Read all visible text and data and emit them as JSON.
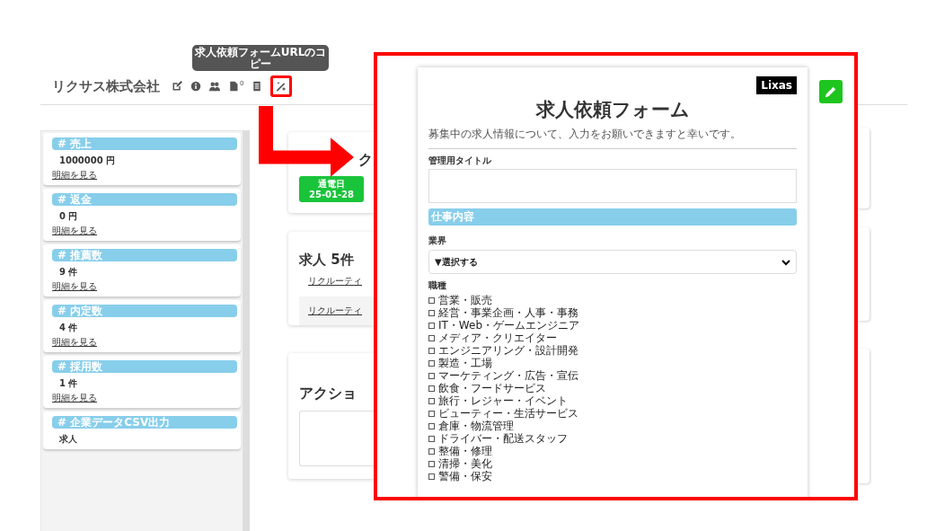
{
  "header": {
    "company": "リクサス株式会社",
    "file_count": "0",
    "tooltip": "求人依頼フォームURLのコピー"
  },
  "sidebar": {
    "cards": [
      {
        "title": "# 売上",
        "value": "1000000 円",
        "link": "明細を見る"
      },
      {
        "title": "# 返金",
        "value": "0 円",
        "link": "明細を見る"
      },
      {
        "title": "# 推薦数",
        "value": "9 件",
        "link": "明細を見る"
      },
      {
        "title": "# 内定数",
        "value": "4 件",
        "link": "明細を見る"
      },
      {
        "title": "# 採用数",
        "value": "1 件",
        "link": "明細を見る"
      },
      {
        "title": "# 企業データCSV出力",
        "value": "求人"
      }
    ]
  },
  "main": {
    "schedule_card": {
      "title": "ク",
      "date_label": "通電日",
      "date": "25-01-28"
    },
    "jobs_card": {
      "title": "求人 5件",
      "rows": [
        "リクルーティ",
        "リクルーティ"
      ]
    },
    "action_card": {
      "title": "アクショ"
    }
  },
  "form": {
    "logo": "Lixas",
    "title": "求人依頼フォーム",
    "intro": "募集中の求人情報について、入力をお願いできますと幸いです。",
    "title_field_label": "管理用タイトル",
    "section": "仕事内容",
    "industry_label": "業界",
    "industry_value": "▼選択する",
    "job_types_label": "職種",
    "job_types": [
      {
        "label": "営業・販売",
        "checked": false
      },
      {
        "label": "経営・事業企画・人事・事務",
        "checked": false
      },
      {
        "label": "IT・Web・ゲームエンジニア",
        "checked": false
      },
      {
        "label": "メディア・クリエイター",
        "checked": false
      },
      {
        "label": "エンジニアリング・設計開発",
        "checked": false
      },
      {
        "label": "製造・工場",
        "checked": false
      },
      {
        "label": "マーケティング・広告・宣伝",
        "checked": false
      },
      {
        "label": "飲食・フードサービス",
        "checked": false
      },
      {
        "label": "旅行・レジャー・イベント",
        "checked": false
      },
      {
        "label": "ビューティー・生活サービス",
        "checked": false
      },
      {
        "label": "倉庫・物流管理",
        "checked": false
      },
      {
        "label": "ドライバー・配送スタッフ",
        "checked": false
      },
      {
        "label": "整備・修理",
        "checked": false
      },
      {
        "label": "清掃・美化",
        "checked": false
      },
      {
        "label": "警備・保安",
        "checked": false
      }
    ]
  }
}
